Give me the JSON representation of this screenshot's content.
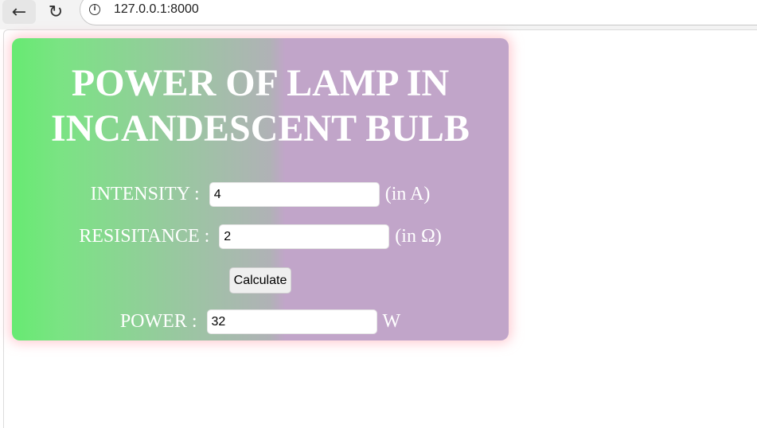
{
  "browser": {
    "back_icon": "←",
    "reload_icon": "↻",
    "info_icon": "i",
    "url": "127.0.0.1:8000"
  },
  "card": {
    "title_line1": "POWER OF LAMP IN",
    "title_line2": "INCANDESCENT BULB",
    "intensity": {
      "label": "INTENSITY :",
      "value": "4",
      "unit": "(in A)"
    },
    "resistance": {
      "label": "RESISITANCE :",
      "value": "2",
      "unit": "(in Ω)"
    },
    "calculate_label": "Calculate",
    "power": {
      "label": "POWER :",
      "value": "32",
      "unit": "W"
    }
  }
}
